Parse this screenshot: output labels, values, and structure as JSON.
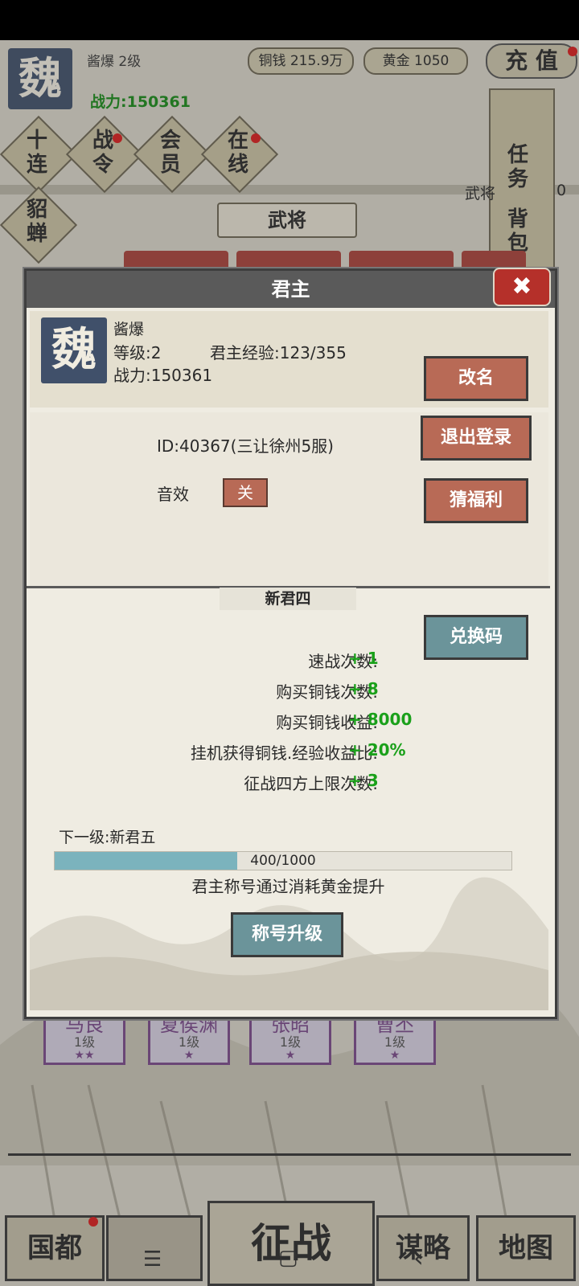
{
  "header": {
    "kingdom_char": "魏",
    "player_name_level": "酱爆  2级",
    "power": "战力:150361",
    "copper": "铜钱 215.9万",
    "gold": "黄金 1050",
    "recharge": "充 值"
  },
  "menu": {
    "ten_draw": "十\n连",
    "battle_pass": "战\n令",
    "member": "会\n员",
    "online": "在\n线",
    "diaochan": "貂\n蝉",
    "task": "任\n务",
    "bag": "背\n包",
    "generals_tab": "武将",
    "generals_side": "武将",
    "count_partial": "0"
  },
  "generals": [
    {
      "name": "马良",
      "level": "1级",
      "stars": "★★"
    },
    {
      "name": "夏侯渊",
      "level": "1级",
      "stars": "★"
    },
    {
      "name": "张昭",
      "level": "1级",
      "stars": "★"
    },
    {
      "name": "曹丕",
      "level": "1级",
      "stars": "★"
    }
  ],
  "bottom_nav": {
    "capital": "国都",
    "campaign": "征战",
    "strategy": "谋略",
    "map": "地图"
  },
  "modal": {
    "title": "君主",
    "close": "✖",
    "avatar_char": "魏",
    "name": "酱爆",
    "level": "等级:2",
    "exp": "君主经验:123/355",
    "power": "战力:150361",
    "rename_btn": "改名",
    "id_line": "ID:40367(三让徐州5服)",
    "logout_btn": "退出登录",
    "sound_label": "音效",
    "sound_value": "关",
    "guess_btn": "猜福利",
    "rank_title": "新君四",
    "redeem_btn": "兑换码",
    "bonuses": [
      {
        "label": "速战次数:",
        "value": "+ 1"
      },
      {
        "label": "购买铜钱次数:",
        "value": "+ 8"
      },
      {
        "label": "购买铜钱收益:",
        "value": "+ 8000"
      },
      {
        "label": "挂机获得铜钱.经验收益比:",
        "value": "+ 20%"
      },
      {
        "label": "征战四方上限次数:",
        "value": "+ 3"
      }
    ],
    "next_level": "下一级:新君五",
    "progress": {
      "current": 400,
      "max": 1000,
      "text": "400/1000"
    },
    "hint": "君主称号通过消耗黄金提升",
    "upgrade_btn": "称号升级"
  },
  "system_nav": {
    "menu": "☰",
    "home": "▢",
    "back": "‹"
  },
  "colors": {
    "accent_red": "#b86a56",
    "accent_teal": "#6b949a",
    "bonus_green": "#1aa01a",
    "power_green": "#1a8a1a",
    "header_grey": "#5a5a5a",
    "kingdom_blue": "#40506a"
  }
}
